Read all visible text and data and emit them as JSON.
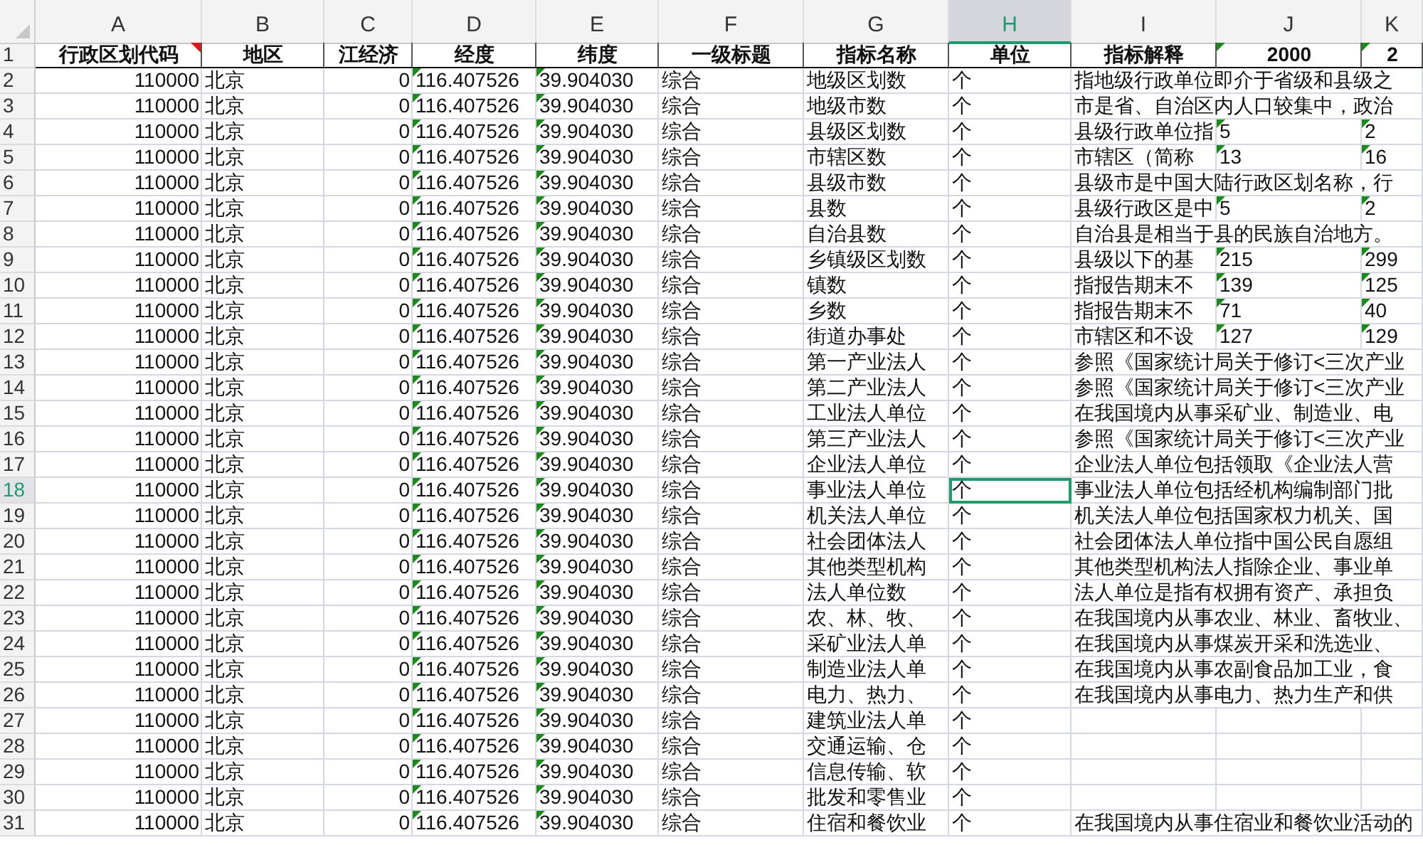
{
  "columns": [
    {
      "letter": "A",
      "selected": false,
      "flag": false
    },
    {
      "letter": "B",
      "selected": false,
      "flag": false
    },
    {
      "letter": "C",
      "selected": false,
      "flag": false
    },
    {
      "letter": "D",
      "selected": false,
      "flag": true
    },
    {
      "letter": "E",
      "selected": false,
      "flag": true
    },
    {
      "letter": "F",
      "selected": false,
      "flag": false
    },
    {
      "letter": "G",
      "selected": false,
      "flag": false
    },
    {
      "letter": "H",
      "selected": true,
      "flag": false
    },
    {
      "letter": "I",
      "selected": false,
      "flag": false
    },
    {
      "letter": "J",
      "selected": false,
      "flag": true
    },
    {
      "letter": "K",
      "selected": false,
      "flag": true
    }
  ],
  "header_row": {
    "number": "1",
    "cells": [
      {
        "text": "行政区划代码",
        "comment": true,
        "flag": false
      },
      {
        "text": "地区",
        "comment": false,
        "flag": false
      },
      {
        "text": "江经济",
        "comment": false,
        "flag": false
      },
      {
        "text": "经度",
        "comment": false,
        "flag": false
      },
      {
        "text": "纬度",
        "comment": false,
        "flag": false
      },
      {
        "text": "一级标题",
        "comment": false,
        "flag": false
      },
      {
        "text": "指标名称",
        "comment": false,
        "flag": false
      },
      {
        "text": "单位",
        "comment": false,
        "flag": false
      },
      {
        "text": "指标解释",
        "comment": false,
        "flag": false
      },
      {
        "text": "2000",
        "comment": false,
        "flag": true
      },
      {
        "text": "2",
        "comment": false,
        "flag": true
      }
    ]
  },
  "rows": [
    {
      "number": "2",
      "selected": false,
      "cells": [
        "110000",
        "北京",
        "0",
        "116.407526",
        "39.904030",
        "综合",
        "地级区划数",
        "个",
        "指地级行政单位即介于省级和县级之"
      ]
    },
    {
      "number": "3",
      "selected": false,
      "cells": [
        "110000",
        "北京",
        "0",
        "116.407526",
        "39.904030",
        "综合",
        "地级市数",
        "个",
        "市是省、自治区内人口较集中，政治"
      ]
    },
    {
      "number": "4",
      "selected": false,
      "cells": [
        "110000",
        "北京",
        "0",
        "116.407526",
        "39.904030",
        "综合",
        "县级区划数",
        "个",
        "县级行政单位指",
        "5",
        "2"
      ]
    },
    {
      "number": "5",
      "selected": false,
      "cells": [
        "110000",
        "北京",
        "0",
        "116.407526",
        "39.904030",
        "综合",
        "市辖区数",
        "个",
        "市辖区（简称",
        "13",
        "16"
      ]
    },
    {
      "number": "6",
      "selected": false,
      "cells": [
        "110000",
        "北京",
        "0",
        "116.407526",
        "39.904030",
        "综合",
        "县级市数",
        "个",
        "县级市是中国大陆行政区划名称，行"
      ]
    },
    {
      "number": "7",
      "selected": false,
      "cells": [
        "110000",
        "北京",
        "0",
        "116.407526",
        "39.904030",
        "综合",
        "县数",
        "个",
        "县级行政区是中",
        "5",
        "2"
      ]
    },
    {
      "number": "8",
      "selected": false,
      "cells": [
        "110000",
        "北京",
        "0",
        "116.407526",
        "39.904030",
        "综合",
        "自治县数",
        "个",
        "自治县是相当于县的民族自治地方。"
      ]
    },
    {
      "number": "9",
      "selected": false,
      "cells": [
        "110000",
        "北京",
        "0",
        "116.407526",
        "39.904030",
        "综合",
        "乡镇级区划数",
        "个",
        "县级以下的基",
        "215",
        "299"
      ]
    },
    {
      "number": "10",
      "selected": false,
      "cells": [
        "110000",
        "北京",
        "0",
        "116.407526",
        "39.904030",
        "综合",
        "镇数",
        "个",
        "指报告期末不",
        "139",
        "125"
      ]
    },
    {
      "number": "11",
      "selected": false,
      "cells": [
        "110000",
        "北京",
        "0",
        "116.407526",
        "39.904030",
        "综合",
        "乡数",
        "个",
        "指报告期末不",
        "71",
        "40"
      ]
    },
    {
      "number": "12",
      "selected": false,
      "cells": [
        "110000",
        "北京",
        "0",
        "116.407526",
        "39.904030",
        "综合",
        "街道办事处",
        "个",
        "市辖区和不设",
        "127",
        "129"
      ]
    },
    {
      "number": "13",
      "selected": false,
      "cells": [
        "110000",
        "北京",
        "0",
        "116.407526",
        "39.904030",
        "综合",
        "第一产业法人",
        "个",
        "参照《国家统计局关于修订<三次产业"
      ]
    },
    {
      "number": "14",
      "selected": false,
      "cells": [
        "110000",
        "北京",
        "0",
        "116.407526",
        "39.904030",
        "综合",
        "第二产业法人",
        "个",
        "参照《国家统计局关于修订<三次产业"
      ]
    },
    {
      "number": "15",
      "selected": false,
      "cells": [
        "110000",
        "北京",
        "0",
        "116.407526",
        "39.904030",
        "综合",
        "工业法人单位",
        "个",
        "在我国境内从事采矿业、制造业、电"
      ]
    },
    {
      "number": "16",
      "selected": false,
      "cells": [
        "110000",
        "北京",
        "0",
        "116.407526",
        "39.904030",
        "综合",
        "第三产业法人",
        "个",
        "参照《国家统计局关于修订<三次产业"
      ]
    },
    {
      "number": "17",
      "selected": false,
      "cells": [
        "110000",
        "北京",
        "0",
        "116.407526",
        "39.904030",
        "综合",
        "企业法人单位",
        "个",
        "企业法人单位包括领取《企业法人营"
      ]
    },
    {
      "number": "18",
      "selected": true,
      "cells": [
        "110000",
        "北京",
        "0",
        "116.407526",
        "39.904030",
        "综合",
        "事业法人单位",
        "个",
        "事业法人单位包括经机构编制部门批"
      ]
    },
    {
      "number": "19",
      "selected": false,
      "cells": [
        "110000",
        "北京",
        "0",
        "116.407526",
        "39.904030",
        "综合",
        "机关法人单位",
        "个",
        "机关法人单位包括国家权力机关、国"
      ]
    },
    {
      "number": "20",
      "selected": false,
      "cells": [
        "110000",
        "北京",
        "0",
        "116.407526",
        "39.904030",
        "综合",
        "社会团体法人",
        "个",
        "社会团体法人单位指中国公民自愿组"
      ]
    },
    {
      "number": "21",
      "selected": false,
      "cells": [
        "110000",
        "北京",
        "0",
        "116.407526",
        "39.904030",
        "综合",
        "其他类型机构",
        "个",
        "其他类型机构法人指除企业、事业单"
      ]
    },
    {
      "number": "22",
      "selected": false,
      "cells": [
        "110000",
        "北京",
        "0",
        "116.407526",
        "39.904030",
        "综合",
        "法人单位数",
        "个",
        "法人单位是指有权拥有资产、承担负"
      ]
    },
    {
      "number": "23",
      "selected": false,
      "cells": [
        "110000",
        "北京",
        "0",
        "116.407526",
        "39.904030",
        "综合",
        "农、林、牧、",
        "个",
        "在我国境内从事农业、林业、畜牧业、"
      ]
    },
    {
      "number": "24",
      "selected": false,
      "cells": [
        "110000",
        "北京",
        "0",
        "116.407526",
        "39.904030",
        "综合",
        "采矿业法人单",
        "个",
        "在我国境内从事煤炭开采和洗选业、"
      ]
    },
    {
      "number": "25",
      "selected": false,
      "cells": [
        "110000",
        "北京",
        "0",
        "116.407526",
        "39.904030",
        "综合",
        "制造业法人单",
        "个",
        "在我国境内从事农副食品加工业，食"
      ]
    },
    {
      "number": "26",
      "selected": false,
      "cells": [
        "110000",
        "北京",
        "0",
        "116.407526",
        "39.904030",
        "综合",
        "电力、热力、",
        "个",
        "在我国境内从事电力、热力生产和供"
      ]
    },
    {
      "number": "27",
      "selected": false,
      "cells": [
        "110000",
        "北京",
        "0",
        "116.407526",
        "39.904030",
        "综合",
        "建筑业法人单",
        "个"
      ]
    },
    {
      "number": "28",
      "selected": false,
      "cells": [
        "110000",
        "北京",
        "0",
        "116.407526",
        "39.904030",
        "综合",
        "交通运输、仓",
        "个"
      ]
    },
    {
      "number": "29",
      "selected": false,
      "cells": [
        "110000",
        "北京",
        "0",
        "116.407526",
        "39.904030",
        "综合",
        "信息传输、软",
        "个"
      ]
    },
    {
      "number": "30",
      "selected": false,
      "cells": [
        "110000",
        "北京",
        "0",
        "116.407526",
        "39.904030",
        "综合",
        "批发和零售业",
        "个"
      ]
    },
    {
      "number": "31",
      "selected": false,
      "cells": [
        "110000",
        "北京",
        "0",
        "116.407526",
        "39.904030",
        "综合",
        "住宿和餐饮业",
        "个",
        "在我国境内从事住宿业和餐饮业活动的"
      ]
    }
  ]
}
